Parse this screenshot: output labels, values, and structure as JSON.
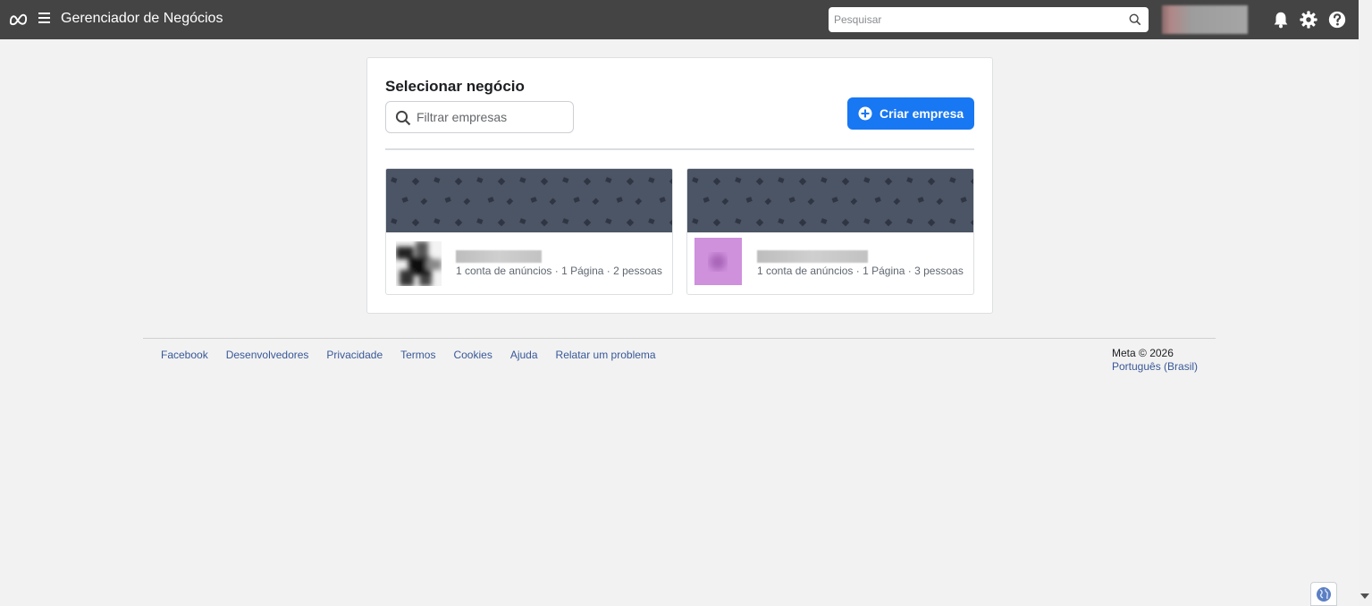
{
  "header": {
    "app_title": "Gerenciador de Negócios",
    "search_placeholder": "Pesquisar",
    "icons": [
      "meta-logo",
      "hamburger-menu-icon",
      "search-icon",
      "bell-icon",
      "gear-icon",
      "help-icon"
    ]
  },
  "panel": {
    "title": "Selecionar negócio",
    "filter_placeholder": "Filtrar empresas",
    "create_button_label": "Criar empresa",
    "businesses": [
      {
        "meta": "1 conta de anúncios · 1 Página · 2 pessoas",
        "avatar_color": "#2b2b2b"
      },
      {
        "meta": "1 conta de anúncios · 1 Página · 3 pessoas",
        "avatar_color": "#c78fd6"
      }
    ]
  },
  "footer": {
    "links": [
      "Facebook",
      "Desenvolvedores",
      "Privacidade",
      "Termos",
      "Cookies",
      "Ajuda",
      "Relatar um problema"
    ],
    "copyright": "Meta © 2026",
    "language": "Português (Brasil)"
  },
  "colors": {
    "topbar": "#444444",
    "primary_button": "#1877f2",
    "link": "#385898",
    "banner": "#4b5565"
  }
}
